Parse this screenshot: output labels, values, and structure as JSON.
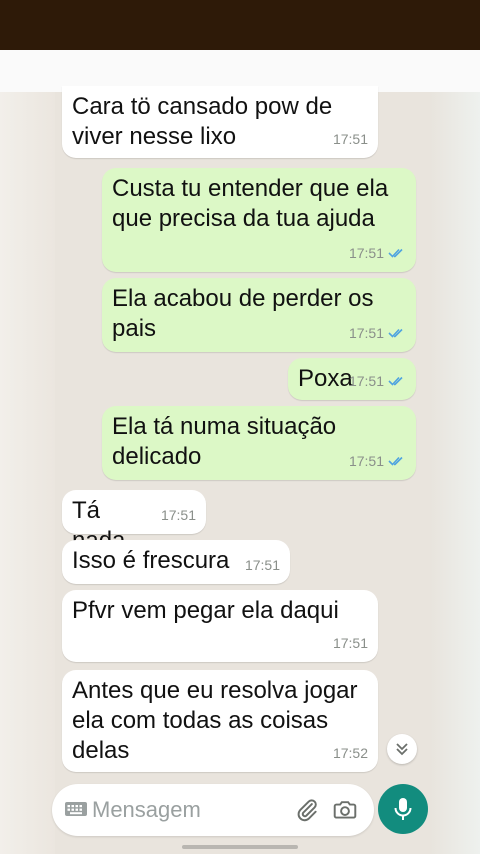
{
  "messages": [
    {
      "direction": "in",
      "text": "Cara tö cansado pow de\nviver nesse lixo",
      "time": "17:51",
      "read": false
    },
    {
      "direction": "out",
      "text": "Custa tu entender que ela\nque precisa da tua ajuda",
      "time": "17:51",
      "read": true
    },
    {
      "direction": "out",
      "text": "Ela acabou de perder os\npais",
      "time": "17:51",
      "read": true
    },
    {
      "direction": "out",
      "text": "Poxa",
      "time": "17:51",
      "read": true
    },
    {
      "direction": "out",
      "text": "Ela tá numa situação\ndelicado",
      "time": "17:51",
      "read": true
    },
    {
      "direction": "in",
      "text": "Tá nada",
      "time": "17:51",
      "read": false
    },
    {
      "direction": "in",
      "text": "Isso é frescura",
      "time": "17:51",
      "read": false
    },
    {
      "direction": "in",
      "text": "Pfvr vem pegar ela daqui",
      "time": "17:51",
      "read": false
    },
    {
      "direction": "in",
      "text": "Antes que eu resolva jogar\nela com todas as coisas\ndelas",
      "time": "17:52",
      "read": false
    }
  ],
  "composer": {
    "placeholder": "Mensagem",
    "icons": [
      "keyboard-icon",
      "paperclip-icon",
      "camera-icon",
      "microphone-icon"
    ]
  },
  "colors": {
    "incoming_bubble": "#ffffff",
    "outgoing_bubble": "#dcf8c6",
    "read_ticks": "#4fa3e0",
    "mic_button": "#128c7e",
    "top_bar": "#2e1a08"
  }
}
